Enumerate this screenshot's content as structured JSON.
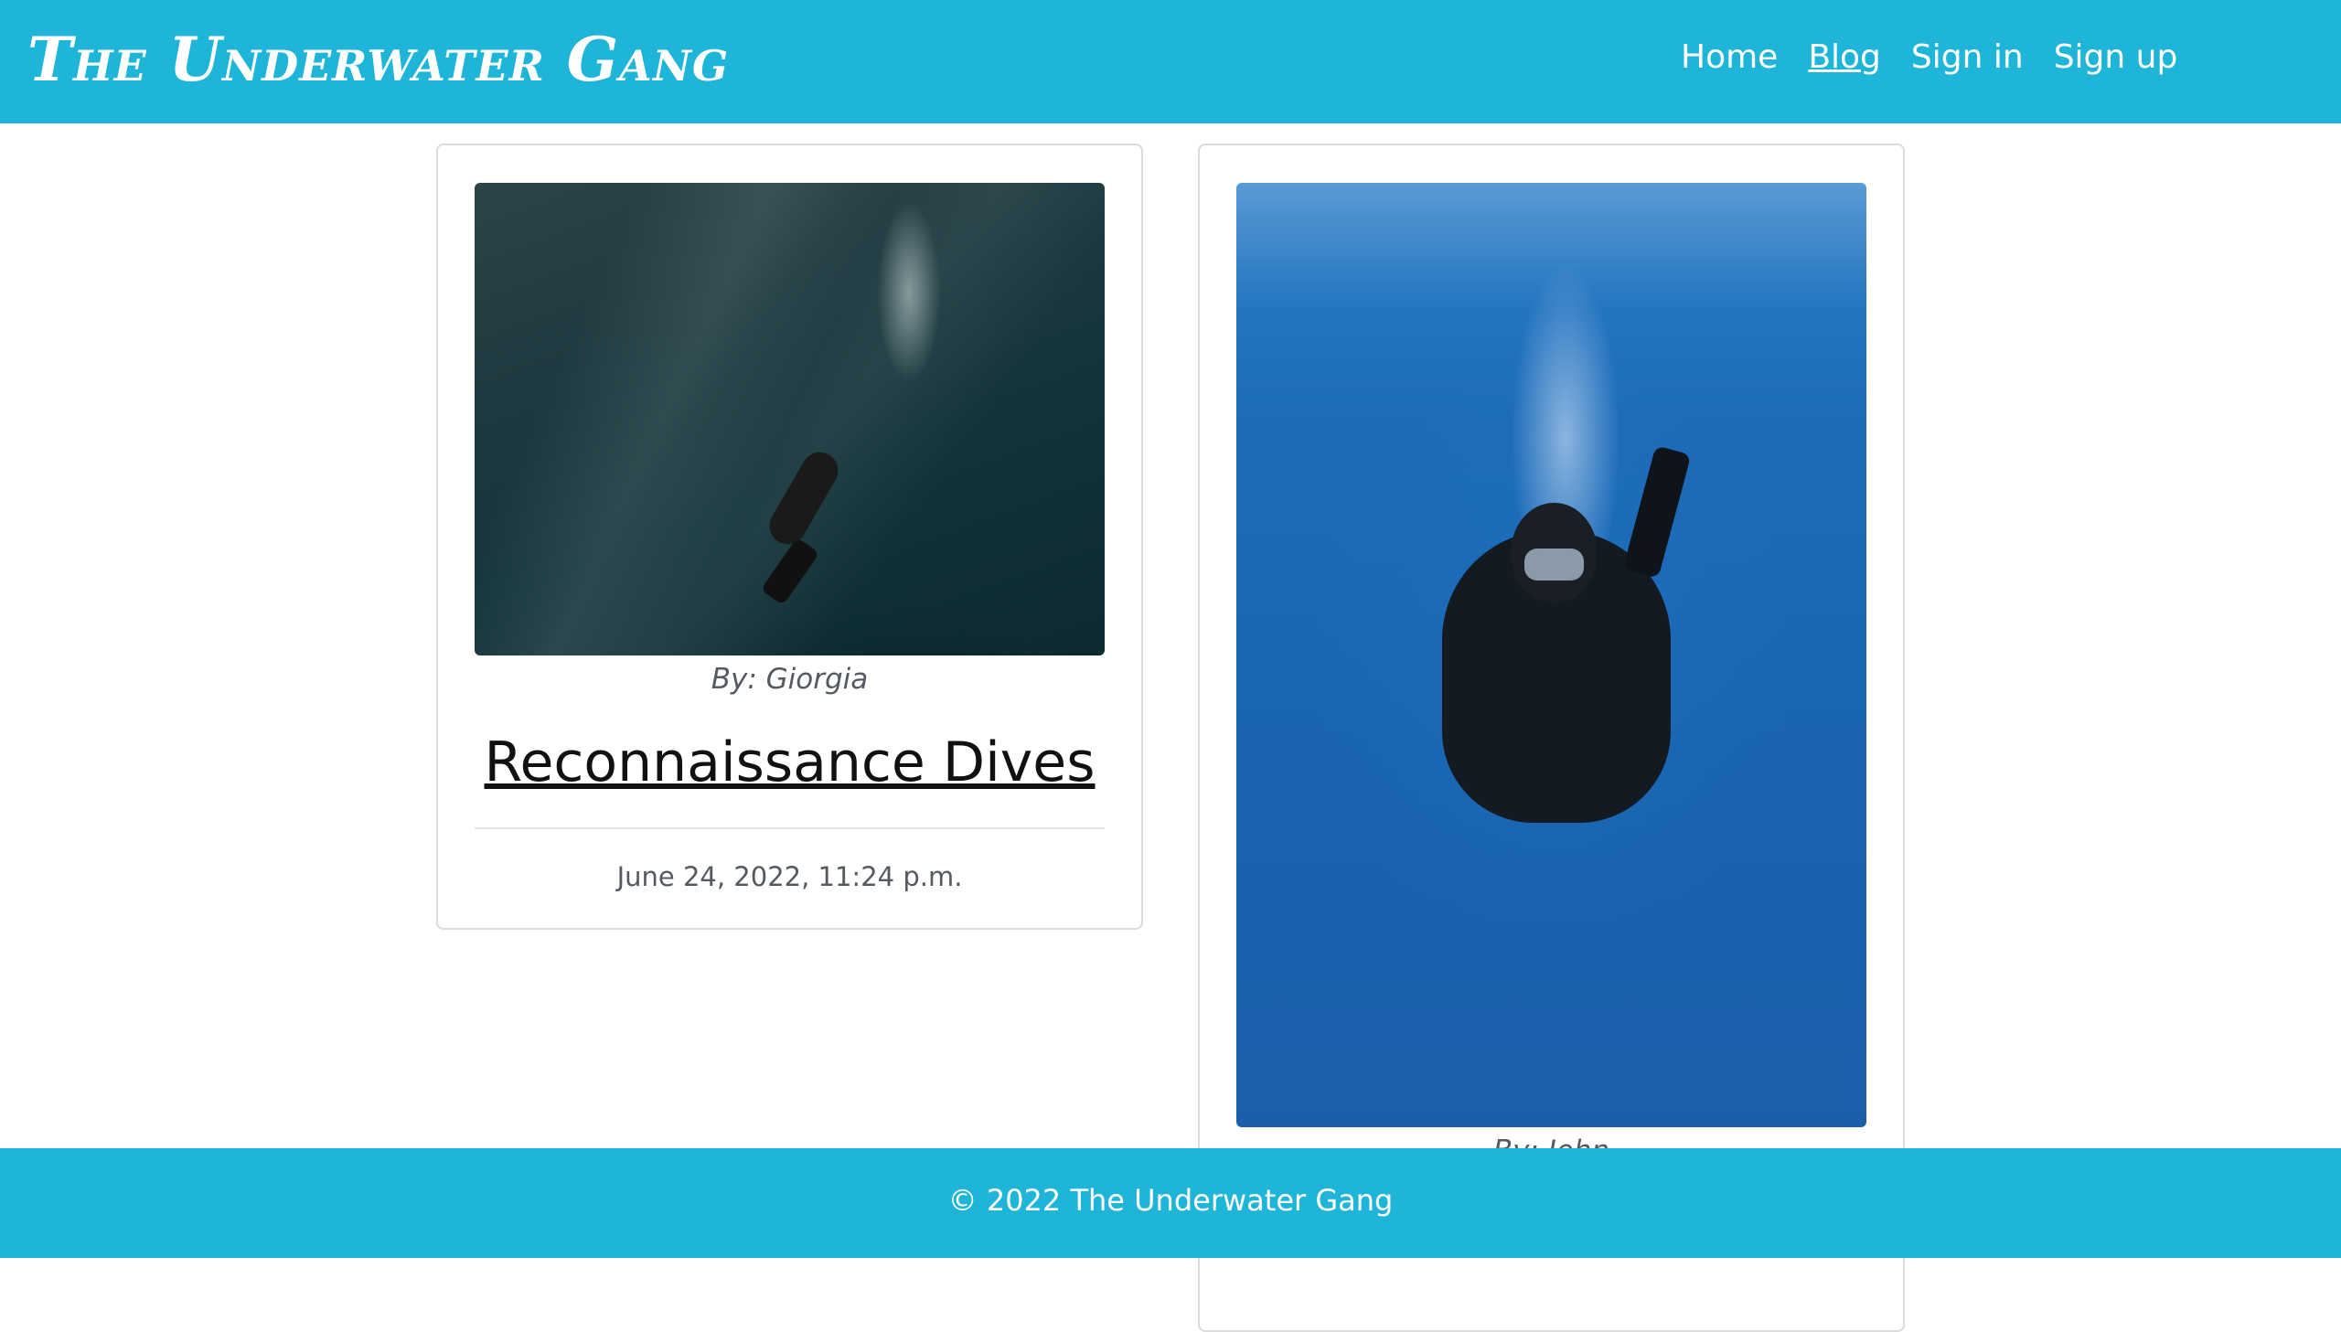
{
  "navbar": {
    "brand": "The Underwater Gang",
    "links": [
      {
        "label": "Home",
        "active": false
      },
      {
        "label": "Blog",
        "active": true
      },
      {
        "label": "Sign in",
        "active": false
      },
      {
        "label": "Sign up",
        "active": false
      }
    ]
  },
  "posts": [
    {
      "author": "By: Giorgia",
      "title": "Reconnaissance Dives",
      "date": "June 24, 2022, 11:24 p.m.",
      "image": "diver-descending-reef-photo"
    },
    {
      "author": "By: John",
      "image": "scuba-diver-blue-water-photo"
    }
  ],
  "footer": {
    "text": "© 2022 The Underwater Gang"
  },
  "colors": {
    "accent": "#1fb5d8",
    "text_muted": "#555a60"
  }
}
